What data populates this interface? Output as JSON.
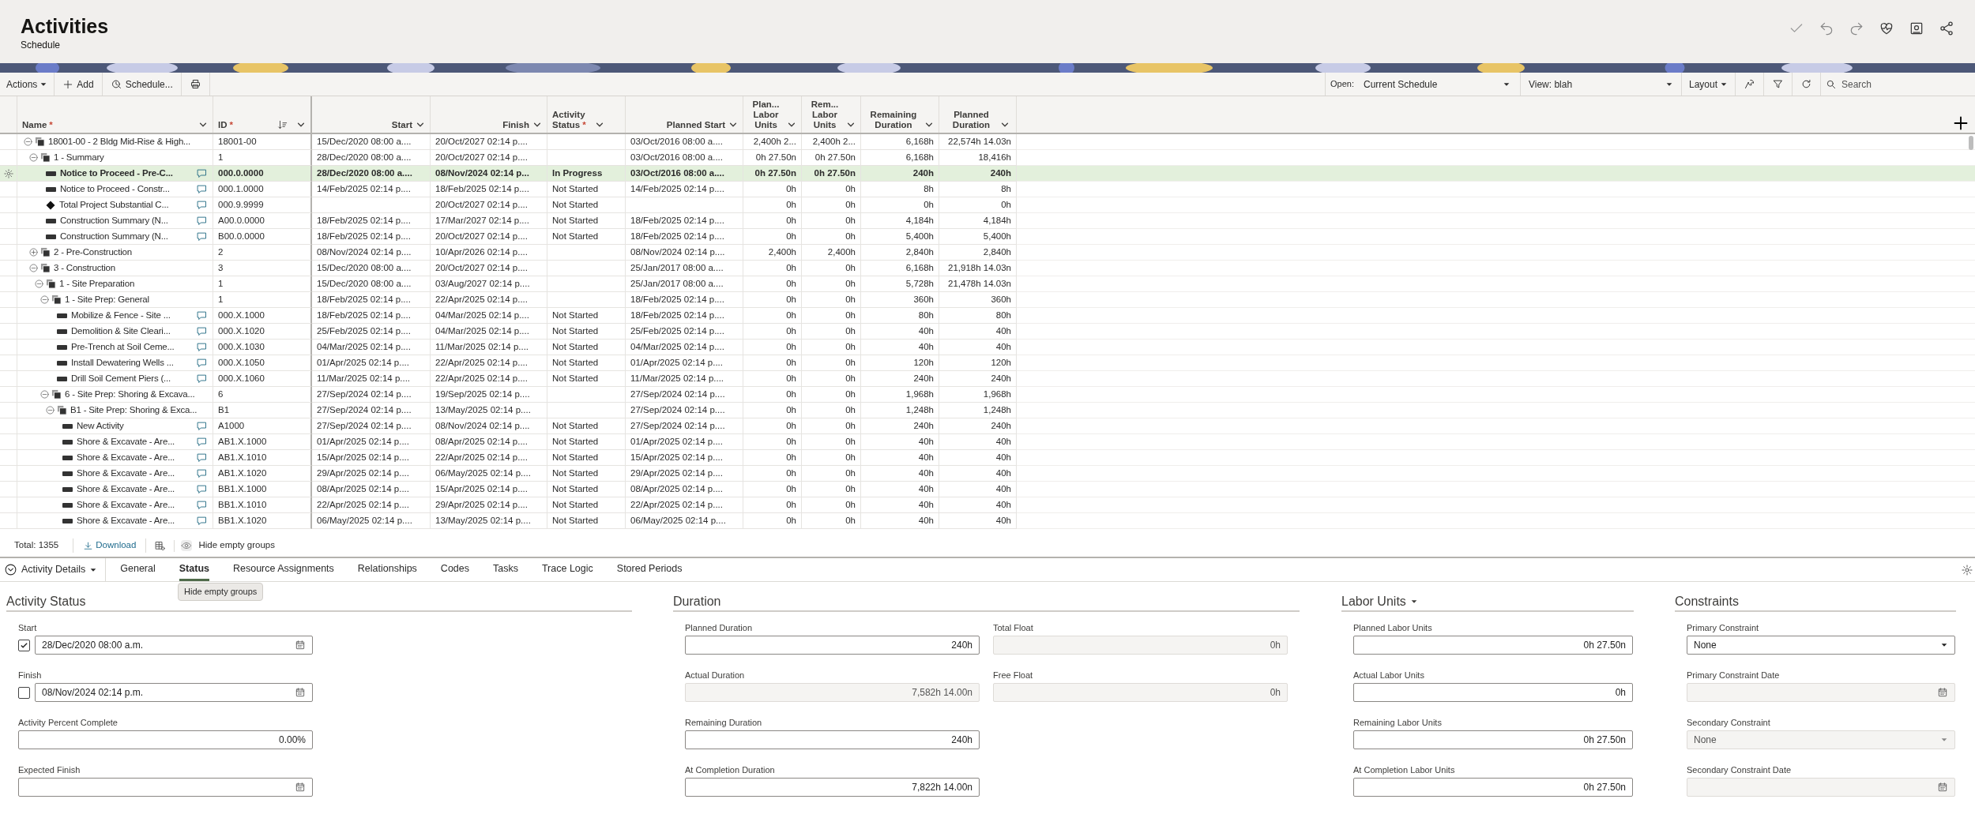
{
  "page": {
    "title": "Activities",
    "subtitle": "Schedule"
  },
  "toolbar": {
    "actions": "Actions",
    "add": "Add",
    "schedule": "Schedule...",
    "open_label": "Open:",
    "open_value": "Current Schedule",
    "view": "View: blah",
    "layout": "Layout",
    "search_placeholder": "Search"
  },
  "table": {
    "columns": [
      {
        "label": "Name",
        "mark": "*",
        "sorted": false
      },
      {
        "label": "ID",
        "mark": "*",
        "sorted": true
      },
      {
        "label": "Start",
        "sorted": false
      },
      {
        "label": "Finish",
        "sorted": false
      },
      {
        "label": "Activity Status",
        "mark": "*",
        "sorted": false
      },
      {
        "label": "Planned Start",
        "sorted": false
      },
      {
        "label": "Plan... Labor Units",
        "sorted": false
      },
      {
        "label": "Rem... Labor Units",
        "sorted": false
      },
      {
        "label": "Remaining Duration",
        "sorted": false
      },
      {
        "label": "Planned Duration",
        "sorted": false
      }
    ],
    "rows": [
      {
        "kind": "wbs",
        "expanded": true,
        "selected": false,
        "name": "18001-00 - 2 Bldg Mid-Rise & High...",
        "id": "18001-00",
        "start": "15/Dec/2020 08:00 a....",
        "finish": "20/Oct/2027 02:14 p....",
        "planned_start": "03/Oct/2016 08:00 a....",
        "planned_labor": "2,400h 2...",
        "remaining_labor": "2,400h 2...",
        "remaining_duration": "6,168h",
        "planned_duration": "22,574h 14.03n",
        "children": [
          {
            "kind": "wbs",
            "expanded": true,
            "selected": false,
            "name": "1 - Summary",
            "id": "1",
            "start": "28/Dec/2020 08:00 a....",
            "finish": "20/Oct/2027 02:14 p....",
            "planned_start": "03/Oct/2016 08:00 a....",
            "planned_labor": "0h 27.50n",
            "remaining_labor": "0h 27.50n",
            "remaining_duration": "6,168h",
            "planned_duration": "18,416h",
            "children": [
              {
                "kind": "task",
                "selected": true,
                "name": "Notice to Proceed - Pre-C...",
                "id": "000.0.0000",
                "start": "28/Dec/2020 08:00 a....",
                "finish": "08/Nov/2024 02:14 p...",
                "status": "In Progress",
                "planned_start": "03/Oct/2016 08:00 a....",
                "planned_labor": "0h 27.50n",
                "remaining_labor": "0h 27.50n",
                "remaining_duration": "240h",
                "planned_duration": "240h"
              },
              {
                "kind": "task",
                "selected": false,
                "name": "Notice to Proceed - Constr...",
                "id": "000.1.0000",
                "start": "14/Feb/2025 02:14 p....",
                "finish": "18/Feb/2025 02:14 p....",
                "status": "Not Started",
                "planned_start": "14/Feb/2025 02:14 p....",
                "planned_labor": "0h",
                "remaining_labor": "0h",
                "remaining_duration": "8h",
                "planned_duration": "8h"
              },
              {
                "kind": "milestone",
                "selected": false,
                "name": "Total Project Substantial C...",
                "id": "000.9.9999",
                "finish": "20/Oct/2027 02:14 p....",
                "status": "Not Started",
                "planned_labor": "0h",
                "remaining_labor": "0h",
                "remaining_duration": "0h",
                "planned_duration": "0h"
              },
              {
                "kind": "task",
                "selected": false,
                "name": "Construction Summary (N...",
                "id": "A00.0.0000",
                "start": "18/Feb/2025 02:14 p....",
                "finish": "17/Mar/2027 02:14 p....",
                "status": "Not Started",
                "planned_start": "18/Feb/2025 02:14 p....",
                "planned_labor": "0h",
                "remaining_labor": "0h",
                "remaining_duration": "4,184h",
                "planned_duration": "4,184h"
              },
              {
                "kind": "task",
                "selected": false,
                "name": "Construction Summary (N...",
                "id": "B00.0.0000",
                "start": "18/Feb/2025 02:14 p....",
                "finish": "20/Oct/2027 02:14 p....",
                "status": "Not Started",
                "planned_start": "18/Feb/2025 02:14 p....",
                "planned_labor": "0h",
                "remaining_labor": "0h",
                "remaining_duration": "5,400h",
                "planned_duration": "5,400h"
              }
            ]
          },
          {
            "kind": "wbs",
            "expanded": false,
            "selected": false,
            "name": "2 - Pre-Construction",
            "id": "2",
            "start": "08/Nov/2024 02:14 p....",
            "finish": "10/Apr/2026 02:14 p....",
            "planned_start": "08/Nov/2024 02:14 p....",
            "planned_labor": "2,400h",
            "remaining_labor": "2,400h",
            "remaining_duration": "2,840h",
            "planned_duration": "2,840h"
          },
          {
            "kind": "wbs",
            "expanded": true,
            "selected": false,
            "name": "3 - Construction",
            "id": "3",
            "start": "15/Dec/2020 08:00 a....",
            "finish": "20/Oct/2027 02:14 p....",
            "planned_start": "25/Jan/2017 08:00 a....",
            "planned_labor": "0h",
            "remaining_labor": "0h",
            "remaining_duration": "6,168h",
            "planned_duration": "21,918h 14.03n",
            "children": [
              {
                "kind": "wbs",
                "expanded": true,
                "selected": false,
                "name": "1 - Site Preparation",
                "id": "1",
                "start": "15/Dec/2020 08:00 a....",
                "finish": "03/Aug/2027 02:14 p....",
                "planned_start": "25/Jan/2017 08:00 a....",
                "planned_labor": "0h",
                "remaining_labor": "0h",
                "remaining_duration": "5,728h",
                "planned_duration": "21,478h 14.03n",
                "children": [
                  {
                    "kind": "wbs",
                    "expanded": true,
                    "selected": false,
                    "name": "1 - Site Prep: General",
                    "id": "1",
                    "start": "18/Feb/2025 02:14 p....",
                    "finish": "22/Apr/2025 02:14 p....",
                    "planned_start": "18/Feb/2025 02:14 p....",
                    "planned_labor": "0h",
                    "remaining_labor": "0h",
                    "remaining_duration": "360h",
                    "planned_duration": "360h",
                    "children": [
                      {
                        "kind": "task",
                        "selected": false,
                        "name": "Mobilize & Fence - Site ...",
                        "id": "000.X.1000",
                        "start": "18/Feb/2025 02:14 p....",
                        "finish": "04/Mar/2025 02:14 p....",
                        "status": "Not Started",
                        "planned_start": "18/Feb/2025 02:14 p....",
                        "planned_labor": "0h",
                        "remaining_labor": "0h",
                        "remaining_duration": "80h",
                        "planned_duration": "80h"
                      },
                      {
                        "kind": "task",
                        "selected": false,
                        "name": "Demolition & Site Cleari...",
                        "id": "000.X.1020",
                        "start": "25/Feb/2025 02:14 p....",
                        "finish": "04/Mar/2025 02:14 p....",
                        "status": "Not Started",
                        "planned_start": "25/Feb/2025 02:14 p....",
                        "planned_labor": "0h",
                        "remaining_labor": "0h",
                        "remaining_duration": "40h",
                        "planned_duration": "40h"
                      },
                      {
                        "kind": "task",
                        "selected": false,
                        "name": "Pre-Trench at Soil Ceme...",
                        "id": "000.X.1030",
                        "start": "04/Mar/2025 02:14 p....",
                        "finish": "11/Mar/2025 02:14 p....",
                        "status": "Not Started",
                        "planned_start": "04/Mar/2025 02:14 p....",
                        "planned_labor": "0h",
                        "remaining_labor": "0h",
                        "remaining_duration": "40h",
                        "planned_duration": "40h"
                      },
                      {
                        "kind": "task",
                        "selected": false,
                        "name": "Install Dewatering Wells ...",
                        "id": "000.X.1050",
                        "start": "01/Apr/2025 02:14 p....",
                        "finish": "22/Apr/2025 02:14 p....",
                        "status": "Not Started",
                        "planned_start": "01/Apr/2025 02:14 p....",
                        "planned_labor": "0h",
                        "remaining_labor": "0h",
                        "remaining_duration": "120h",
                        "planned_duration": "120h"
                      },
                      {
                        "kind": "task",
                        "selected": false,
                        "name": "Drill Soil Cement Piers (...",
                        "id": "000.X.1060",
                        "start": "11/Mar/2025 02:14 p....",
                        "finish": "22/Apr/2025 02:14 p....",
                        "status": "Not Started",
                        "planned_start": "11/Mar/2025 02:14 p....",
                        "planned_labor": "0h",
                        "remaining_labor": "0h",
                        "remaining_duration": "240h",
                        "planned_duration": "240h"
                      }
                    ]
                  },
                  {
                    "kind": "wbs",
                    "expanded": true,
                    "selected": false,
                    "name": "6 - Site Prep: Shoring & Excava...",
                    "id": "6",
                    "start": "27/Sep/2024 02:14 p....",
                    "finish": "19/Sep/2025 02:14 p....",
                    "planned_start": "27/Sep/2024 02:14 p....",
                    "planned_labor": "0h",
                    "remaining_labor": "0h",
                    "remaining_duration": "1,968h",
                    "planned_duration": "1,968h",
                    "children": [
                      {
                        "kind": "wbs",
                        "expanded": true,
                        "selected": false,
                        "name": "B1 - Site Prep: Shoring & Exca...",
                        "id": "B1",
                        "start": "27/Sep/2024 02:14 p....",
                        "finish": "13/May/2025 02:14 p....",
                        "planned_start": "27/Sep/2024 02:14 p....",
                        "planned_labor": "0h",
                        "remaining_labor": "0h",
                        "remaining_duration": "1,248h",
                        "planned_duration": "1,248h",
                        "children": [
                          {
                            "kind": "task",
                            "selected": false,
                            "name": "New Activity",
                            "id": "A1000",
                            "start": "27/Sep/2024 02:14 p....",
                            "finish": "08/Nov/2024 02:14 p....",
                            "status": "Not Started",
                            "planned_start": "27/Sep/2024 02:14 p....",
                            "planned_labor": "0h",
                            "remaining_labor": "0h",
                            "remaining_duration": "240h",
                            "planned_duration": "240h"
                          },
                          {
                            "kind": "task",
                            "selected": false,
                            "name": "Shore & Excavate - Are...",
                            "id": "AB1.X.1000",
                            "start": "01/Apr/2025 02:14 p....",
                            "finish": "08/Apr/2025 02:14 p....",
                            "status": "Not Started",
                            "planned_start": "01/Apr/2025 02:14 p....",
                            "planned_labor": "0h",
                            "remaining_labor": "0h",
                            "remaining_duration": "40h",
                            "planned_duration": "40h"
                          },
                          {
                            "kind": "task",
                            "selected": false,
                            "name": "Shore & Excavate - Are...",
                            "id": "AB1.X.1010",
                            "start": "15/Apr/2025 02:14 p....",
                            "finish": "22/Apr/2025 02:14 p....",
                            "status": "Not Started",
                            "planned_start": "15/Apr/2025 02:14 p....",
                            "planned_labor": "0h",
                            "remaining_labor": "0h",
                            "remaining_duration": "40h",
                            "planned_duration": "40h"
                          },
                          {
                            "kind": "task",
                            "selected": false,
                            "name": "Shore & Excavate - Are...",
                            "id": "AB1.X.1020",
                            "start": "29/Apr/2025 02:14 p....",
                            "finish": "06/May/2025 02:14 p....",
                            "status": "Not Started",
                            "planned_start": "29/Apr/2025 02:14 p....",
                            "planned_labor": "0h",
                            "remaining_labor": "0h",
                            "remaining_duration": "40h",
                            "planned_duration": "40h"
                          },
                          {
                            "kind": "task",
                            "selected": false,
                            "name": "Shore & Excavate - Are...",
                            "id": "BB1.X.1000",
                            "start": "08/Apr/2025 02:14 p....",
                            "finish": "15/Apr/2025 02:14 p....",
                            "status": "Not Started",
                            "planned_start": "08/Apr/2025 02:14 p....",
                            "planned_labor": "0h",
                            "remaining_labor": "0h",
                            "remaining_duration": "40h",
                            "planned_duration": "40h"
                          },
                          {
                            "kind": "task",
                            "selected": false,
                            "name": "Shore & Excavate - Are...",
                            "id": "BB1.X.1010",
                            "start": "22/Apr/2025 02:14 p....",
                            "finish": "29/Apr/2025 02:14 p....",
                            "status": "Not Started",
                            "planned_start": "22/Apr/2025 02:14 p....",
                            "planned_labor": "0h",
                            "remaining_labor": "0h",
                            "remaining_duration": "40h",
                            "planned_duration": "40h"
                          },
                          {
                            "kind": "task",
                            "selected": false,
                            "name": "Shore & Excavate - Are...",
                            "id": "BB1.X.1020",
                            "start": "06/May/2025 02:14 p....",
                            "finish": "13/May/2025 02:14 p....",
                            "status": "Not Started",
                            "planned_start": "06/May/2025 02:14 p....",
                            "planned_labor": "0h",
                            "remaining_labor": "0h",
                            "remaining_duration": "40h",
                            "planned_duration": "40h"
                          }
                        ]
                      }
                    ]
                  }
                ]
              }
            ]
          }
        ]
      }
    ]
  },
  "footer": {
    "total": "Total: 1355",
    "download": "Download",
    "hide_empty": "Hide empty groups"
  },
  "details": {
    "selector": "Activity Details",
    "tooltip": "Hide empty groups",
    "tabs": [
      {
        "label": "General",
        "selected": false
      },
      {
        "label": "Status",
        "selected": true
      },
      {
        "label": "Resource Assignments",
        "selected": false
      },
      {
        "label": "Relationships",
        "selected": false
      },
      {
        "label": "Codes",
        "selected": false
      },
      {
        "label": "Tasks",
        "selected": false
      },
      {
        "label": "Trace Logic",
        "selected": false
      },
      {
        "label": "Stored Periods",
        "selected": false
      }
    ],
    "sections": [
      {
        "title": "Activity Status",
        "menu": false,
        "columns": [
          [
            {
              "label": "Start",
              "kind": "date",
              "checked": true,
              "readonly": false,
              "value": "28/Dec/2020 08:00 a.m."
            },
            {
              "label": "Finish",
              "kind": "date",
              "checked": false,
              "readonly": false,
              "value": "08/Nov/2024 02:14 p.m."
            },
            {
              "label": "Activity Percent Complete",
              "kind": "number",
              "readonly": false,
              "value": "0.00%"
            },
            {
              "label": "Expected Finish",
              "kind": "date",
              "readonly": false
            }
          ]
        ]
      },
      {
        "title": "Duration",
        "menu": false,
        "columns": [
          [
            {
              "label": "Planned Duration",
              "kind": "number",
              "readonly": false,
              "value": "240h"
            },
            {
              "label": "Actual Duration",
              "kind": "number",
              "readonly": true,
              "value": "7,582h 14.00n"
            },
            {
              "label": "Remaining Duration",
              "kind": "number",
              "readonly": false,
              "value": "240h"
            },
            {
              "label": "At Completion Duration",
              "kind": "number",
              "readonly": false,
              "value": "7,822h 14.00n"
            }
          ],
          [
            {
              "label": "Total Float",
              "kind": "number",
              "readonly": true,
              "value": "0h"
            },
            {
              "label": "Free Float",
              "kind": "number",
              "readonly": true,
              "value": "0h"
            }
          ]
        ]
      },
      {
        "title": "Labor Units",
        "menu": true,
        "columns": [
          [
            {
              "label": "Planned Labor Units",
              "kind": "number",
              "readonly": false,
              "value": "0h 27.50n"
            },
            {
              "label": "Actual Labor Units",
              "kind": "number",
              "readonly": false,
              "value": "0h"
            },
            {
              "label": "Remaining Labor Units",
              "kind": "number",
              "readonly": false,
              "value": "0h 27.50n"
            },
            {
              "label": "At Completion Labor Units",
              "kind": "number",
              "readonly": false,
              "value": "0h 27.50n"
            }
          ]
        ]
      },
      {
        "title": "Constraints",
        "menu": false,
        "columns": [
          [
            {
              "label": "Primary Constraint",
              "kind": "select",
              "readonly": false,
              "value": "None"
            },
            {
              "label": "Primary Constraint Date",
              "kind": "date",
              "readonly": true
            },
            {
              "label": "Secondary Constraint",
              "kind": "select",
              "readonly": true,
              "value": "None"
            },
            {
              "label": "Secondary Constraint Date",
              "kind": "date",
              "readonly": true
            }
          ]
        ]
      }
    ]
  }
}
